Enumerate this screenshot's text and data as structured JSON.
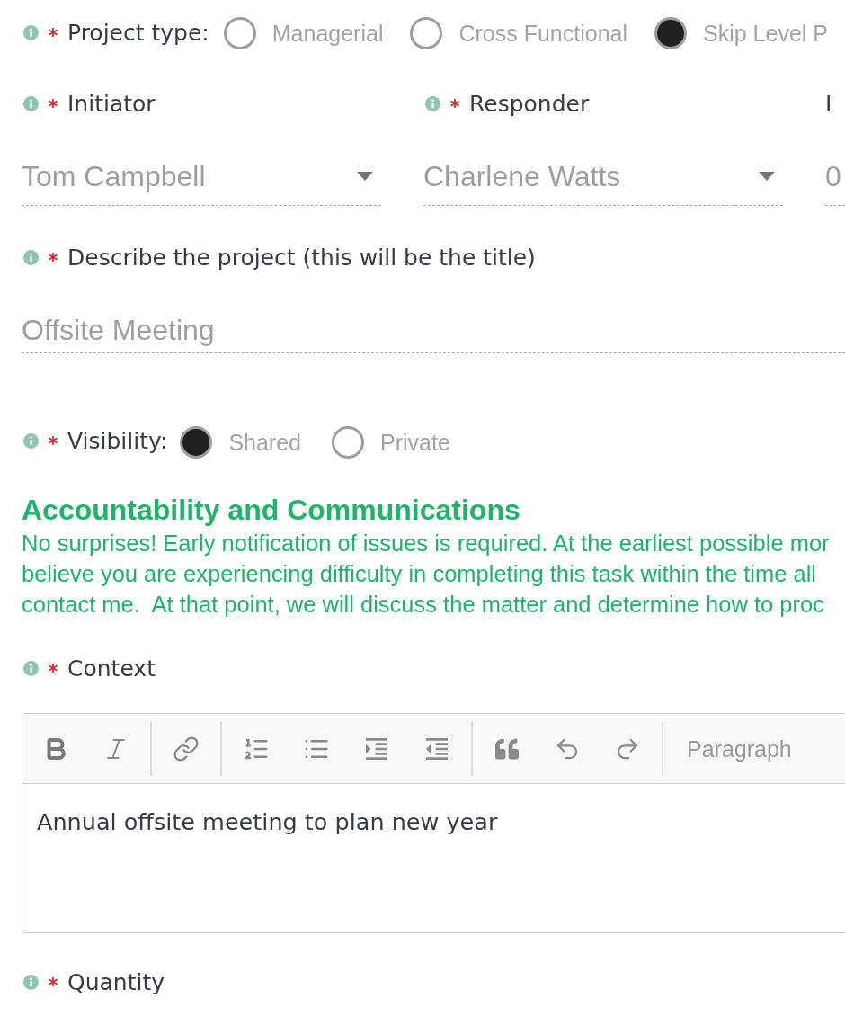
{
  "project_type": {
    "label": "Project type:",
    "info": true,
    "required": true,
    "options": [
      {
        "label": "Managerial",
        "selected": false
      },
      {
        "label": "Cross Functional",
        "selected": false
      },
      {
        "label": "Skip Level P",
        "selected": true
      }
    ]
  },
  "people": [
    {
      "kind": "select",
      "label": "Initiator",
      "info": true,
      "required": true,
      "value": "Tom Campbell"
    },
    {
      "kind": "select",
      "label": "Responder",
      "info": true,
      "required": true,
      "value": "Charlene Watts"
    },
    {
      "kind": "text",
      "label": "I",
      "info": false,
      "required": false,
      "value": "0"
    }
  ],
  "description": {
    "label": "Describe the project (this will be the title)",
    "info": true,
    "required": true,
    "value": "Offsite Meeting"
  },
  "visibility": {
    "label": "Visibility:",
    "info": true,
    "required": true,
    "options": [
      {
        "label": "Shared",
        "selected": true
      },
      {
        "label": "Private",
        "selected": false
      }
    ]
  },
  "notice": {
    "title": "Accountability and Communications",
    "lines": [
      "No surprises! Early notification of issues is required. At the earliest possible mor",
      "believe you are experiencing difficulty in completing this task within the time all",
      "contact me.  At that point, we will discuss the matter and determine how to proc"
    ]
  },
  "context": {
    "label": "Context",
    "info": true,
    "required": true,
    "editor": {
      "block_format": "Paragraph",
      "content": "Annual offsite meeting to plan new year"
    }
  },
  "quantity": {
    "label": "Quantity",
    "info": true,
    "required": true
  }
}
